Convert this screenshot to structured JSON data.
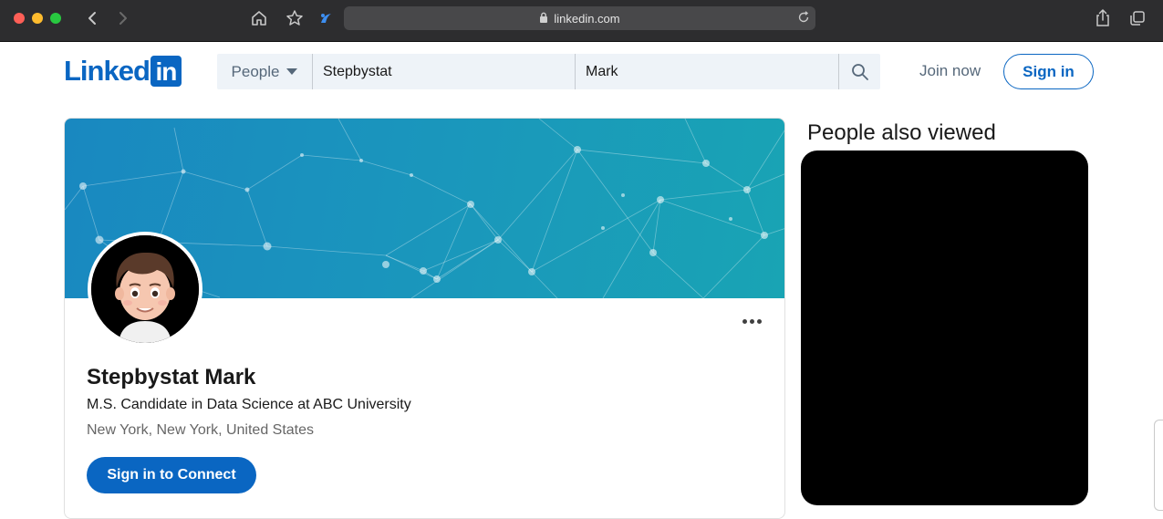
{
  "browser": {
    "url": "linkedin.com"
  },
  "header": {
    "logo_text": "Linked",
    "logo_box": "in",
    "search_dropdown": "People",
    "search_first": "Stepbystat",
    "search_last": "Mark",
    "join_label": "Join now",
    "signin_label": "Sign in"
  },
  "profile": {
    "name": "Stepbystat Mark",
    "headline": "M.S. Candidate in Data Science at ABC University",
    "location": "New York, New York, United States",
    "connect_label": "Sign in to Connect"
  },
  "sidebar": {
    "title": "People also viewed"
  },
  "colors": {
    "brand": "#0a66c2",
    "chrome": "#2d2d2f"
  }
}
